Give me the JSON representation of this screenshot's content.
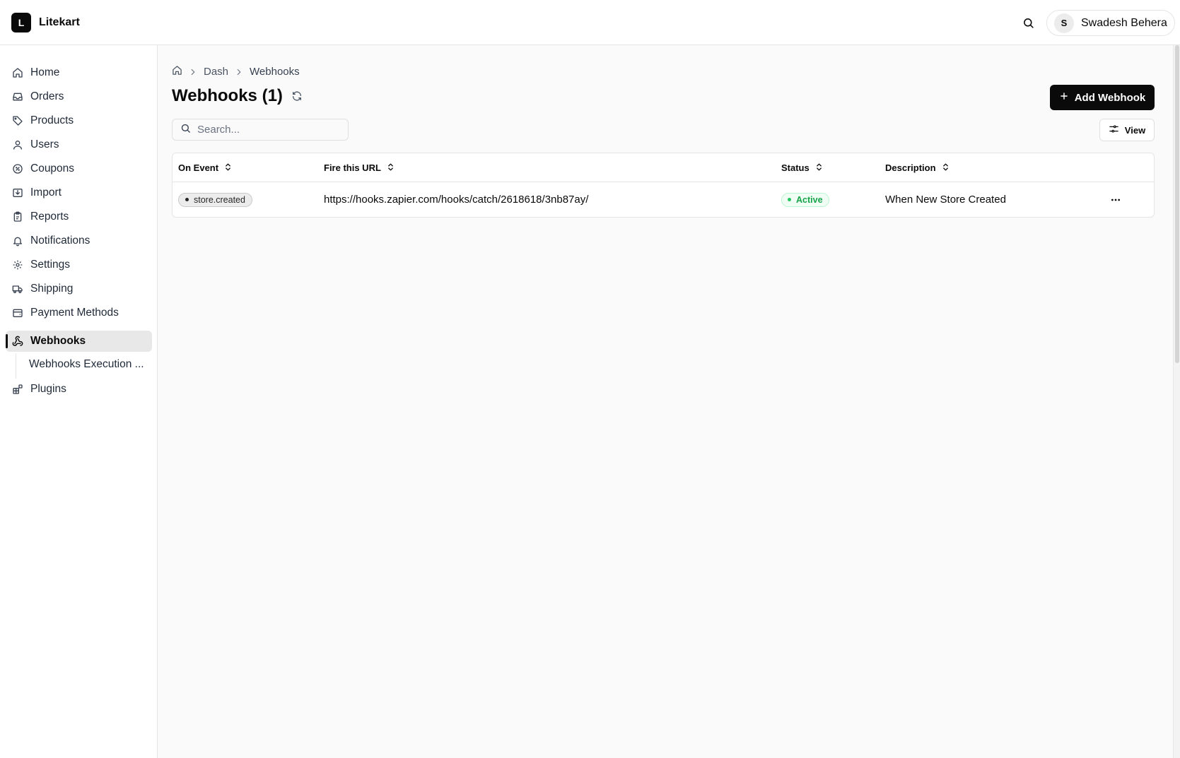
{
  "app": {
    "name": "Litekart",
    "logo_letter": "L"
  },
  "header": {
    "user_initial": "S",
    "user_name": "Swadesh Behera"
  },
  "sidebar": {
    "items": [
      {
        "label": "Home",
        "icon": "home-icon"
      },
      {
        "label": "Orders",
        "icon": "inbox-icon"
      },
      {
        "label": "Products",
        "icon": "tag-icon"
      },
      {
        "label": "Users",
        "icon": "user-icon"
      },
      {
        "label": "Coupons",
        "icon": "coupon-icon"
      },
      {
        "label": "Import",
        "icon": "import-icon"
      },
      {
        "label": "Reports",
        "icon": "clipboard-icon"
      },
      {
        "label": "Notifications",
        "icon": "bell-icon"
      },
      {
        "label": "Settings",
        "icon": "gear-icon"
      },
      {
        "label": "Shipping",
        "icon": "truck-icon"
      },
      {
        "label": "Payment Methods",
        "icon": "wallet-icon"
      },
      {
        "label": "Webhooks",
        "icon": "webhook-icon",
        "active": true
      },
      {
        "label": "Plugins",
        "icon": "blocks-icon"
      }
    ],
    "sub_items": [
      {
        "label": "Webhooks Execution ..."
      }
    ]
  },
  "breadcrumb": {
    "items": [
      "Dash",
      "Webhooks"
    ]
  },
  "page": {
    "title": "Webhooks (1)",
    "add_button": "Add Webhook"
  },
  "search": {
    "placeholder": "Search...",
    "value": ""
  },
  "view_button": "View",
  "table": {
    "columns": [
      "On Event",
      "Fire this URL",
      "Status",
      "Description"
    ],
    "rows": [
      {
        "event": "store.created",
        "url": "https://hooks.zapier.com/hooks/catch/2618618/3nb87ay/",
        "status": "Active",
        "description": "When New Store Created"
      }
    ]
  },
  "colors": {
    "accent": "#0a0a0a",
    "status_active": "#22c55e",
    "active_nav_bg": "#e8e8e8"
  }
}
